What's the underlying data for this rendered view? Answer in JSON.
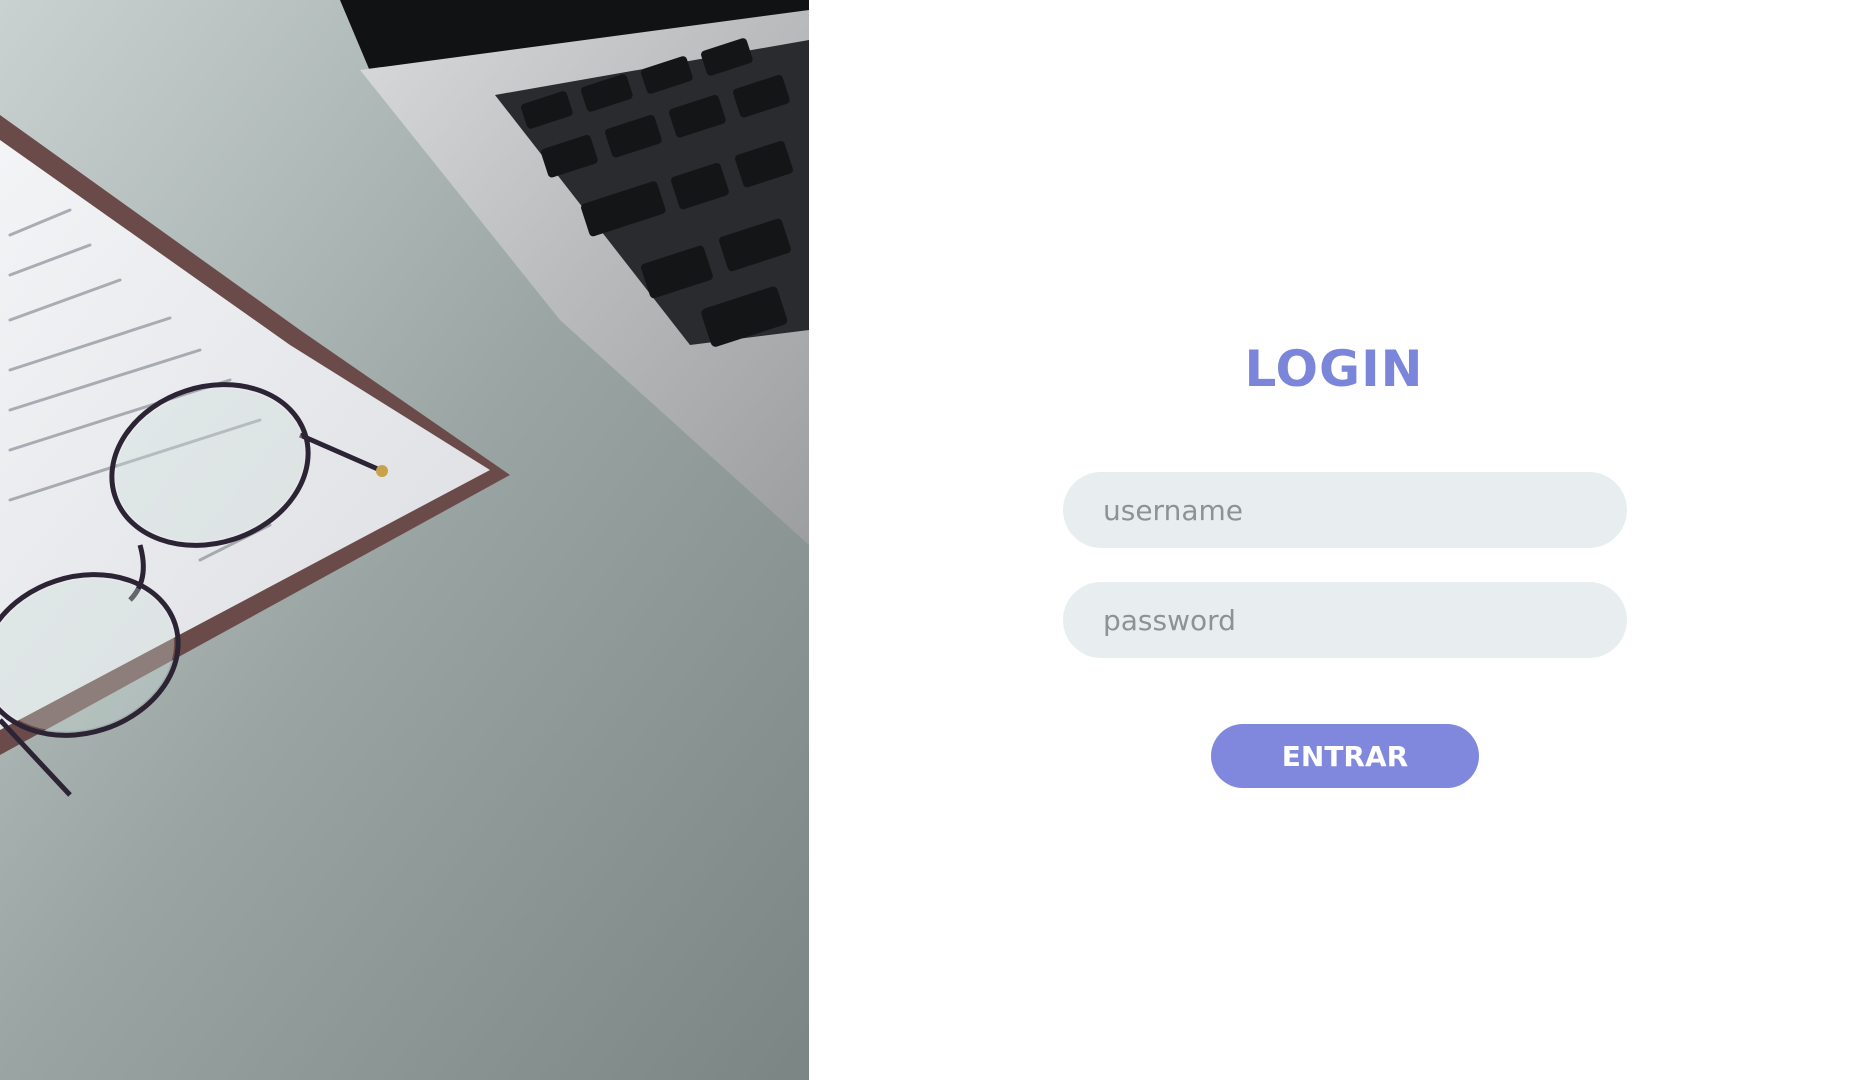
{
  "login": {
    "title": "LOGIN",
    "username_placeholder": "username",
    "password_placeholder": "password",
    "submit_label": "ENTRAR"
  },
  "colors": {
    "accent": "#7b86db",
    "button": "#7f88dd",
    "field_bg": "#e8eef0"
  }
}
